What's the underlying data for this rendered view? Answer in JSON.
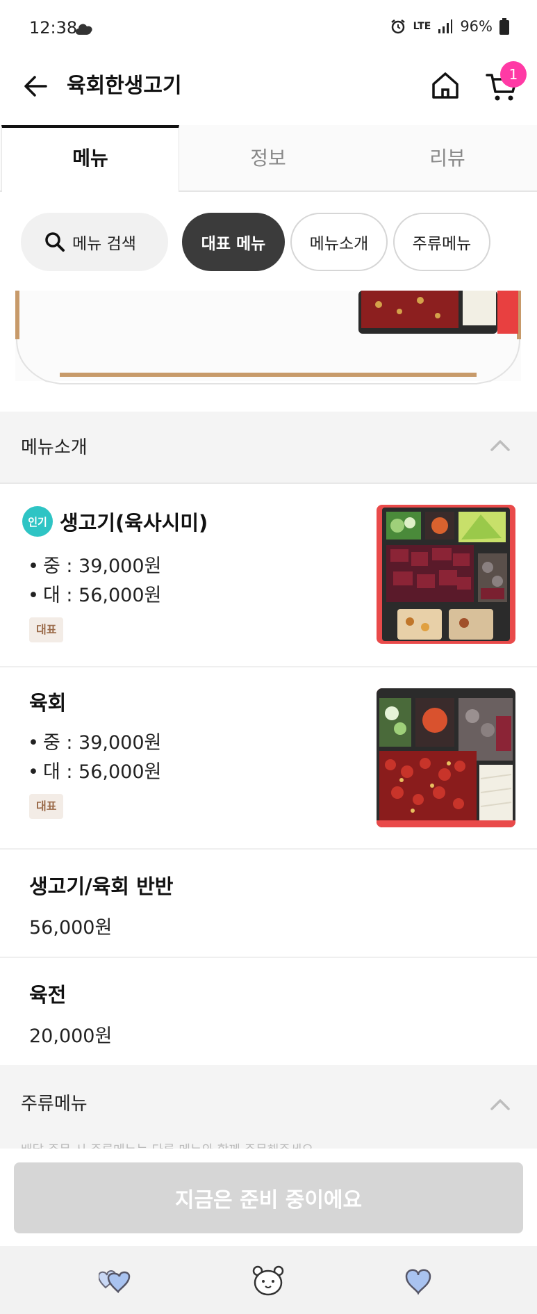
{
  "status_bar": {
    "time": "12:38",
    "network": "LTE",
    "battery": "96%"
  },
  "header": {
    "title": "육회한생고기",
    "cart_count": "1"
  },
  "tabs": [
    {
      "label": "메뉴",
      "active": true
    },
    {
      "label": "정보",
      "active": false
    },
    {
      "label": "리뷰",
      "active": false
    }
  ],
  "chips": {
    "search_label": "메뉴 검색",
    "featured": "대표 메뉴",
    "intro": "메뉴소개",
    "drink": "주류메뉴"
  },
  "sections": {
    "intro_title": "메뉴소개",
    "drink_title": "주류메뉴",
    "drink_notice": "배달 주문 시 주류메뉴는 다른 메뉴와 함께 주문해주세요"
  },
  "menu_items": [
    {
      "name": "생고기(육사시미)",
      "popular_badge": "인기",
      "prices": [
        "중 : 39,000원",
        "대 : 56,000원"
      ],
      "tag": "대표"
    },
    {
      "name": "육회",
      "prices": [
        "중 : 39,000원",
        "대 : 56,000원"
      ],
      "tag": "대표"
    },
    {
      "name": "생고기/육회 반반",
      "price": "56,000원"
    },
    {
      "name": "육전",
      "price": "20,000원"
    }
  ],
  "cta": {
    "label": "지금은 준비 중이에요"
  },
  "colors": {
    "brand_pink": "#ff3aa5",
    "popular_teal": "#2ec4c4",
    "tag_brown": "#9b6b4a"
  }
}
